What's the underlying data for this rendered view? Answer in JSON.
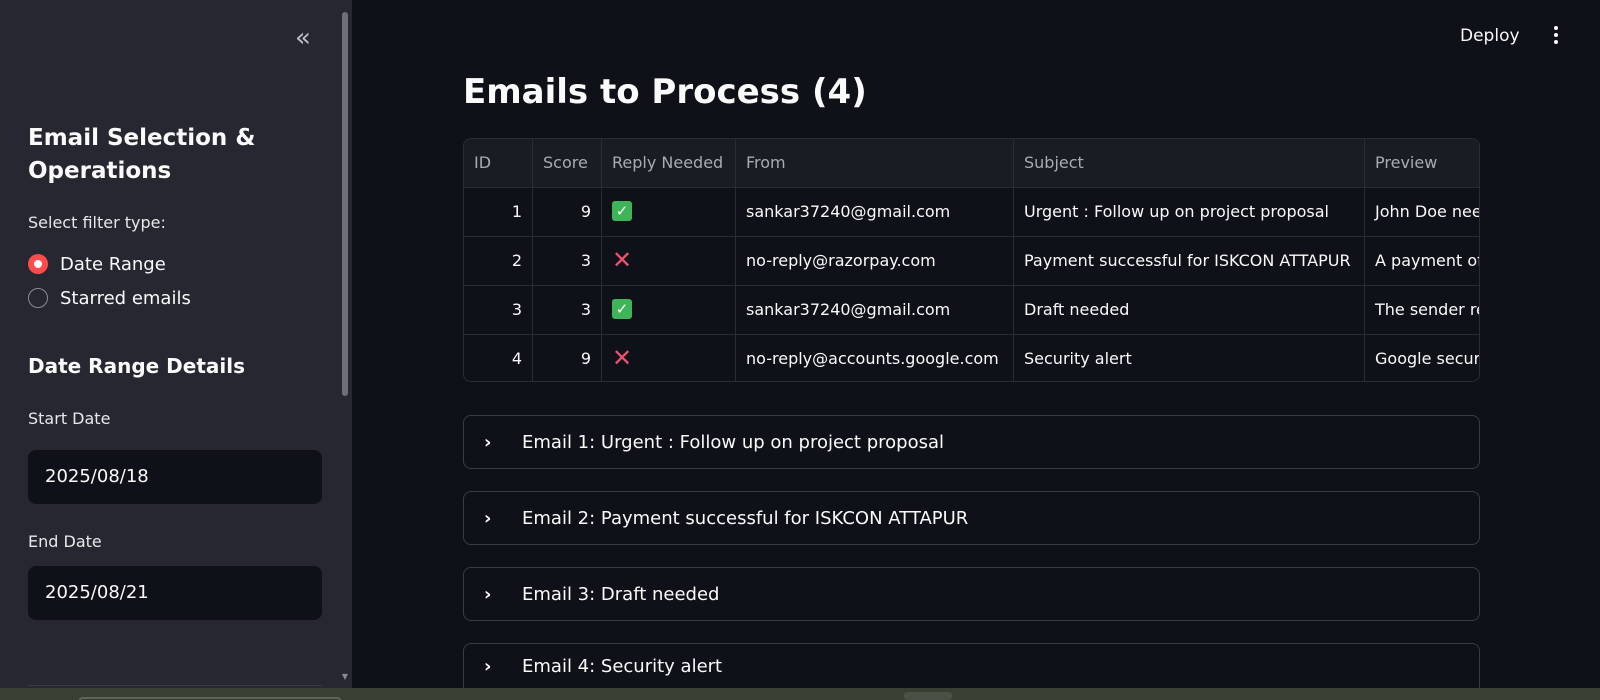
{
  "sidebar": {
    "collapse_glyph": "«",
    "title": "Email Selection & Operations",
    "filter_label": "Select filter type:",
    "filter_options": [
      {
        "label": "Date Range",
        "selected": true
      },
      {
        "label": "Starred emails",
        "selected": false
      }
    ],
    "date_section_title": "Date Range Details",
    "start_date_label": "Start Date",
    "start_date_value": "2025/08/18",
    "end_date_label": "End Date",
    "end_date_value": "2025/08/21"
  },
  "header": {
    "deploy_label": "Deploy",
    "menu_icon": "kebab-menu-icon"
  },
  "main": {
    "title": "Emails to Process (4)",
    "table": {
      "columns": [
        "ID",
        "Score",
        "Reply Needed",
        "From",
        "Subject",
        "Preview"
      ],
      "rows": [
        {
          "id": "1",
          "score": "9",
          "reply": true,
          "from": "sankar37240@gmail.com",
          "subject": "Urgent : Follow up on project proposal",
          "preview": "John Doe nee"
        },
        {
          "id": "2",
          "score": "3",
          "reply": false,
          "from": "no-reply@razorpay.com",
          "subject": "Payment successful for ISKCON ATTAPUR",
          "preview": "A payment of"
        },
        {
          "id": "3",
          "score": "3",
          "reply": true,
          "from": "sankar37240@gmail.com",
          "subject": "Draft needed",
          "preview": "The sender re"
        },
        {
          "id": "4",
          "score": "9",
          "reply": false,
          "from": "no-reply@accounts.google.com",
          "subject": "Security alert",
          "preview": "Google secur"
        }
      ]
    },
    "expanders": [
      {
        "label": "Email 1: Urgent : Follow up on project proposal"
      },
      {
        "label": "Email 2: Payment successful for ISKCON ATTAPUR"
      },
      {
        "label": "Email 3: Draft needed"
      },
      {
        "label": "Email 4: Security alert"
      }
    ]
  },
  "colors": {
    "background": "#0e1117",
    "sidebar": "#262730",
    "accent": "#ff4b4b",
    "check_green": "#3fb55a",
    "cross_red": "#f0506e"
  }
}
